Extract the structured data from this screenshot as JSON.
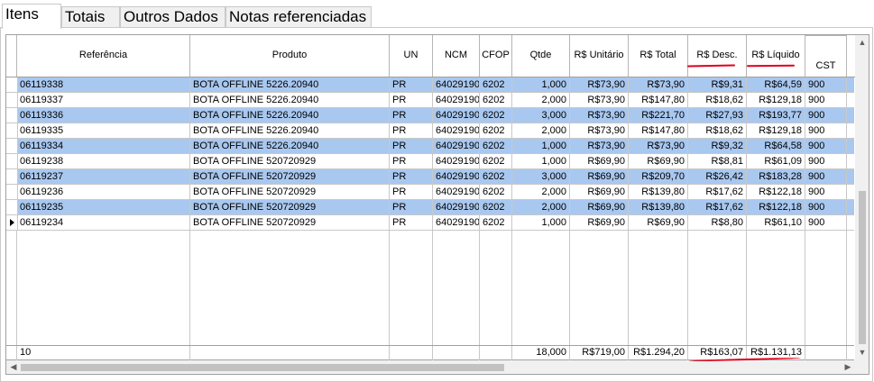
{
  "tabs": [
    {
      "label": "Itens",
      "active": true
    },
    {
      "label": "Totais",
      "active": false
    },
    {
      "label": "Outros Dados",
      "active": false
    },
    {
      "label": "Notas referenciadas",
      "active": false
    }
  ],
  "grid": {
    "columns": [
      "Referência",
      "Produto",
      "UN",
      "NCM",
      "CFOP",
      "Qtde",
      "R$ Unitário",
      "R$ Total",
      "R$ Desc.",
      "R$ Líquido",
      "CST"
    ],
    "rows": [
      {
        "ref": "06119338",
        "produto": "BOTA OFFLINE 5226.20940",
        "un": "PR",
        "ncm": "64029190",
        "cfop": "6202",
        "qtde": "1,000",
        "unit": "R$73,90",
        "total": "R$73,90",
        "desc": "R$9,31",
        "liquido": "R$64,59",
        "cst": "900",
        "selected": true
      },
      {
        "ref": "06119337",
        "produto": "BOTA OFFLINE 5226.20940",
        "un": "PR",
        "ncm": "64029190",
        "cfop": "6202",
        "qtde": "2,000",
        "unit": "R$73,90",
        "total": "R$147,80",
        "desc": "R$18,62",
        "liquido": "R$129,18",
        "cst": "900",
        "selected": false
      },
      {
        "ref": "06119336",
        "produto": "BOTA OFFLINE 5226.20940",
        "un": "PR",
        "ncm": "64029190",
        "cfop": "6202",
        "qtde": "3,000",
        "unit": "R$73,90",
        "total": "R$221,70",
        "desc": "R$27,93",
        "liquido": "R$193,77",
        "cst": "900",
        "selected": true
      },
      {
        "ref": "06119335",
        "produto": "BOTA OFFLINE 5226.20940",
        "un": "PR",
        "ncm": "64029190",
        "cfop": "6202",
        "qtde": "2,000",
        "unit": "R$73,90",
        "total": "R$147,80",
        "desc": "R$18,62",
        "liquido": "R$129,18",
        "cst": "900",
        "selected": false
      },
      {
        "ref": "06119334",
        "produto": "BOTA OFFLINE 5226.20940",
        "un": "PR",
        "ncm": "64029190",
        "cfop": "6202",
        "qtde": "1,000",
        "unit": "R$73,90",
        "total": "R$73,90",
        "desc": "R$9,32",
        "liquido": "R$64,58",
        "cst": "900",
        "selected": true
      },
      {
        "ref": "06119238",
        "produto": "BOTA OFFLINE 520720929",
        "un": "PR",
        "ncm": "64029190",
        "cfop": "6202",
        "qtde": "1,000",
        "unit": "R$69,90",
        "total": "R$69,90",
        "desc": "R$8,81",
        "liquido": "R$61,09",
        "cst": "900",
        "selected": false
      },
      {
        "ref": "06119237",
        "produto": "BOTA OFFLINE 520720929",
        "un": "PR",
        "ncm": "64029190",
        "cfop": "6202",
        "qtde": "3,000",
        "unit": "R$69,90",
        "total": "R$209,70",
        "desc": "R$26,42",
        "liquido": "R$183,28",
        "cst": "900",
        "selected": true
      },
      {
        "ref": "06119236",
        "produto": "BOTA OFFLINE 520720929",
        "un": "PR",
        "ncm": "64029190",
        "cfop": "6202",
        "qtde": "2,000",
        "unit": "R$69,90",
        "total": "R$139,80",
        "desc": "R$17,62",
        "liquido": "R$122,18",
        "cst": "900",
        "selected": false
      },
      {
        "ref": "06119235",
        "produto": "BOTA OFFLINE 520720929",
        "un": "PR",
        "ncm": "64029190",
        "cfop": "6202",
        "qtde": "2,000",
        "unit": "R$69,90",
        "total": "R$139,80",
        "desc": "R$17,62",
        "liquido": "R$122,18",
        "cst": "900",
        "selected": true
      },
      {
        "ref": "06119234",
        "produto": "BOTA OFFLINE 520720929",
        "un": "PR",
        "ncm": "64029190",
        "cfop": "6202",
        "qtde": "1,000",
        "unit": "R$69,90",
        "total": "R$69,90",
        "desc": "R$8,80",
        "liquido": "R$61,10",
        "cst": "900",
        "selected": false,
        "current": true
      }
    ],
    "footer": {
      "count": "10",
      "qtde": "18,000",
      "unit": "R$719,00",
      "total": "R$1.294,20",
      "desc": "R$163,07",
      "liquido": "R$1.131,13"
    }
  },
  "colors": {
    "selected_row": "#a9c8f0",
    "annotation": "#e0001a"
  }
}
